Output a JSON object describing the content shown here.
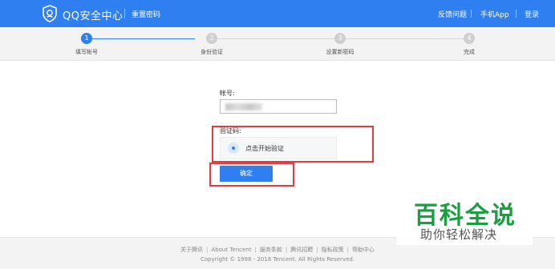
{
  "header": {
    "brand": "QQ安全中心",
    "subtitle": "重置密码",
    "links": [
      "反馈问题",
      "手机App",
      "登录"
    ]
  },
  "steps": [
    {
      "number": "1",
      "label": "填写帐号",
      "active": true
    },
    {
      "number": "2",
      "label": "身份验证",
      "active": false
    },
    {
      "number": "3",
      "label": "设置新密码",
      "active": false
    },
    {
      "number": "4",
      "label": "完成",
      "active": false
    }
  ],
  "form": {
    "account_label": "帐号:",
    "verify_label": "验证码:",
    "verify_text": "点击开始验证",
    "confirm_label": "确定"
  },
  "footer": {
    "links": [
      "关于腾讯",
      "About Tencent",
      "服务条款",
      "腾讯招聘",
      "隐私政策",
      "帮助中心"
    ],
    "separator": "|",
    "copyright": "Copyright © 1998 - 2018 Tencent. All Rights Reserved."
  },
  "watermark": {
    "title": "百科全说",
    "subtitle": "助你轻松解决"
  },
  "colors": {
    "primary": "#2f7ff0",
    "annotation": "#e63a44",
    "watermark_green": "#1a9e3f"
  }
}
